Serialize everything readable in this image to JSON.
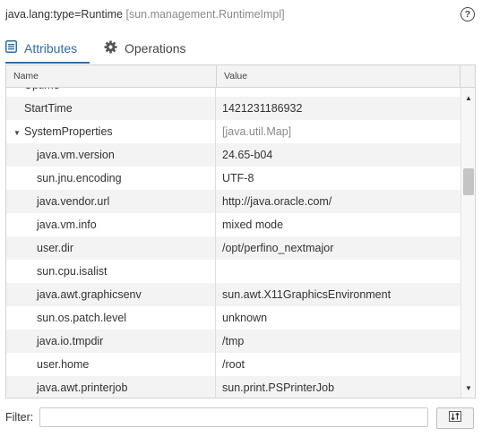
{
  "header": {
    "title": "java.lang:type=Runtime",
    "subtitle": "[sun.management.RuntimeImpl]",
    "help_icon": "help-circle-icon"
  },
  "tabs": [
    {
      "label": "Attributes",
      "icon": "list-icon",
      "active": true
    },
    {
      "label": "Operations",
      "icon": "gear-icon",
      "active": false
    }
  ],
  "table": {
    "columns": [
      "Name",
      "Value"
    ],
    "rows": [
      {
        "name": "Uptime",
        "value": "",
        "indent": 1
      },
      {
        "name": "StartTime",
        "value": "1421231186932",
        "indent": 1
      },
      {
        "name": "SystemProperties",
        "value": "[java.util.Map]",
        "indent": 1,
        "expanded": true
      },
      {
        "name": "java.vm.version",
        "value": "24.65-b04",
        "indent": 2
      },
      {
        "name": "sun.jnu.encoding",
        "value": "UTF-8",
        "indent": 2
      },
      {
        "name": "java.vendor.url",
        "value": "http://java.oracle.com/",
        "indent": 2
      },
      {
        "name": "java.vm.info",
        "value": "mixed mode",
        "indent": 2
      },
      {
        "name": "user.dir",
        "value": "/opt/perfino_nextmajor",
        "indent": 2
      },
      {
        "name": "sun.cpu.isalist",
        "value": "",
        "indent": 2
      },
      {
        "name": "java.awt.graphicsenv",
        "value": "sun.awt.X11GraphicsEnvironment",
        "indent": 2
      },
      {
        "name": "sun.os.patch.level",
        "value": "unknown",
        "indent": 2
      },
      {
        "name": "java.io.tmpdir",
        "value": "/tmp",
        "indent": 2
      },
      {
        "name": "user.home",
        "value": "/root",
        "indent": 2
      },
      {
        "name": "java.awt.printerjob",
        "value": "sun.print.PSPrinterJob",
        "indent": 2
      },
      {
        "name": "",
        "value": "",
        "indent": 2
      }
    ]
  },
  "filter": {
    "label": "Filter:",
    "value": "",
    "placeholder": "",
    "button_icon": "sort-icon"
  },
  "colors": {
    "accent": "#2e6da4",
    "alt_row": "#f3f3f3",
    "muted_text": "#8a8a8a"
  }
}
